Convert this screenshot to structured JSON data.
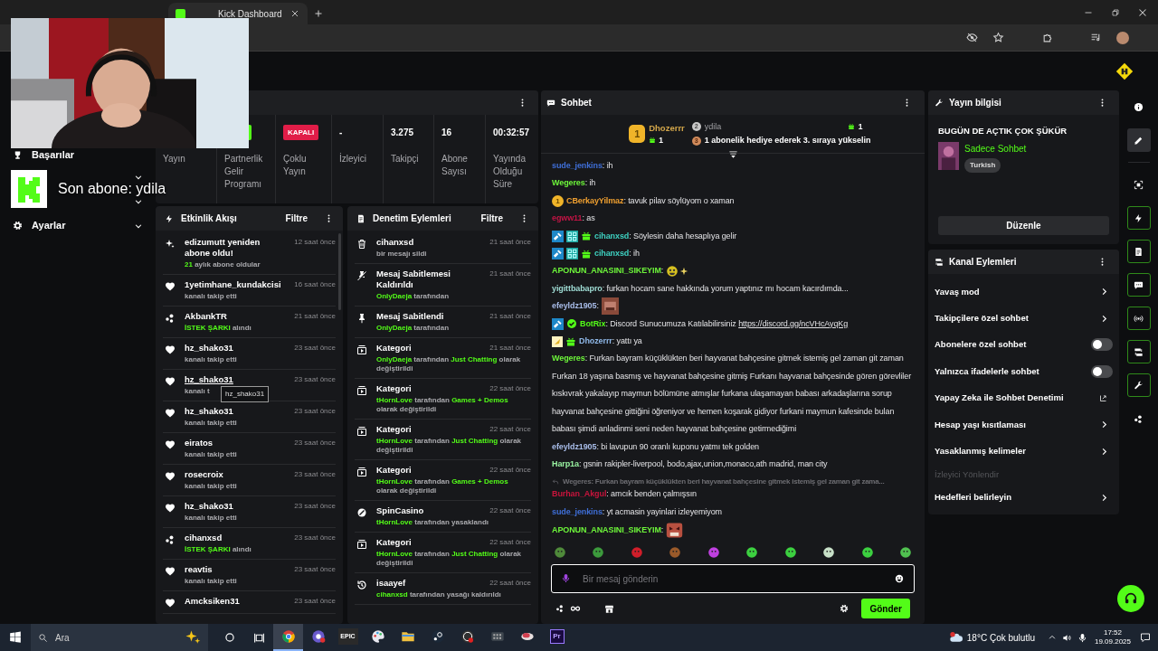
{
  "browser": {
    "tab_title": "Kick Dashboard"
  },
  "overlay": {
    "text": "Son abone: ydila"
  },
  "sidebar": {
    "items": [
      {
        "kind": "trophy",
        "label": "Başarılar"
      },
      {
        "kind": "group",
        "expanded": false
      },
      {
        "kind": "group",
        "expanded": false
      },
      {
        "kind": "gear",
        "label": "Ayarlar",
        "expanded": false
      }
    ]
  },
  "stats": [
    {
      "kind": "hidden",
      "label": "Yayın"
    },
    {
      "kind": "badge",
      "on": true,
      "label": "Partnerlik Gelir Programı"
    },
    {
      "kind": "badge",
      "on": false,
      "value": "KAPALI",
      "label": "Çoklu Yayın"
    },
    {
      "kind": "value",
      "value": "-",
      "label": "İzleyici"
    },
    {
      "kind": "value",
      "value": "3.275",
      "label": "Takipçi"
    },
    {
      "kind": "value",
      "value": "16",
      "label": "Abone Sayısı"
    },
    {
      "kind": "value",
      "value": "00:32:57",
      "label": "Yayında Olduğu Süre"
    }
  ],
  "activity": {
    "title": "Etkinlik Akışı",
    "filter": "Filtre",
    "items": [
      {
        "kind": "resub",
        "title": "edizumutt yeniden abone oldu!",
        "time": "12 saat önce",
        "sub": [
          {
            "text": "21",
            "highlight": true
          },
          {
            "text": " aylık abone oldular",
            "highlight": false
          }
        ]
      },
      {
        "kind": "follow",
        "title": "1yetimhane_kundakcisi",
        "time": "16 saat önce",
        "sub": [
          {
            "text": "kanalı takip etti",
            "highlight": false
          }
        ]
      },
      {
        "kind": "reward",
        "title": "AkbankTR",
        "time": "21 saat önce",
        "sub": [
          {
            "text": "İSTEK ŞARKI",
            "highlight": true
          },
          {
            "text": " alındı",
            "highlight": false
          }
        ]
      },
      {
        "kind": "follow",
        "title": "hz_shako31",
        "time": "23 saat önce",
        "sub": [
          {
            "text": "kanalı takip etti",
            "highlight": false
          }
        ]
      },
      {
        "kind": "follow",
        "title": "hz_shako31",
        "time": "23 saat önce",
        "tooltip": "hz_shako31",
        "sub": [
          {
            "text": "kanalı t",
            "highlight": false
          }
        ]
      },
      {
        "kind": "follow",
        "title": "hz_shako31",
        "time": "23 saat önce",
        "sub": [
          {
            "text": "kanalı takip etti",
            "highlight": false
          }
        ]
      },
      {
        "kind": "follow",
        "title": "eiratos",
        "time": "23 saat önce",
        "sub": [
          {
            "text": "kanalı takip etti",
            "highlight": false
          }
        ]
      },
      {
        "kind": "follow",
        "title": "rosecroix",
        "time": "23 saat önce",
        "sub": [
          {
            "text": "kanalı takip etti",
            "highlight": false
          }
        ]
      },
      {
        "kind": "follow",
        "title": "hz_shako31",
        "time": "23 saat önce",
        "sub": [
          {
            "text": "kanalı takip etti",
            "highlight": false
          }
        ]
      },
      {
        "kind": "reward",
        "title": "cihanxsd",
        "time": "23 saat önce",
        "sub": [
          {
            "text": "İSTEK ŞARKI",
            "highlight": true
          },
          {
            "text": " alındı",
            "highlight": false
          }
        ]
      },
      {
        "kind": "follow",
        "title": "reavtis",
        "time": "23 saat önce",
        "sub": [
          {
            "text": "kanalı takip etti",
            "highlight": false
          }
        ]
      },
      {
        "kind": "follow",
        "title": "Amcksiken31",
        "time": "23 saat önce"
      }
    ]
  },
  "moderation": {
    "title": "Denetim Eylemleri",
    "filter": "Filtre",
    "items": [
      {
        "kind": "delete",
        "title": "cihanxsd",
        "time": "21 saat önce",
        "sub": [
          {
            "text": "bir mesajı sildi",
            "highlight": false
          }
        ]
      },
      {
        "kind": "unpin",
        "title": "Mesaj Sabitlemesi Kaldırıldı",
        "time": "21 saat önce",
        "sub": [
          {
            "text": "OnlyDaeja",
            "highlight": true
          },
          {
            "text": " tarafından",
            "highlight": false
          }
        ]
      },
      {
        "kind": "pin",
        "title": "Mesaj Sabitlendi",
        "time": "21 saat önce",
        "sub": [
          {
            "text": "OnlyDaeja",
            "highlight": true
          },
          {
            "text": " tarafından",
            "highlight": false
          }
        ]
      },
      {
        "kind": "category",
        "title": "Kategori",
        "time": "21 saat önce",
        "sub": [
          {
            "text": "OnlyDaeja",
            "highlight": true
          },
          {
            "text": " tarafından ",
            "highlight": false
          },
          {
            "text": "Just Chatting",
            "highlight": true
          },
          {
            "text": " olarak değiştirildi",
            "highlight": false
          }
        ]
      },
      {
        "kind": "category",
        "title": "Kategori",
        "time": "22 saat önce",
        "sub": [
          {
            "text": "tHornLove",
            "highlight": true
          },
          {
            "text": " tarafından ",
            "highlight": false
          },
          {
            "text": "Games + Demos",
            "highlight": true
          },
          {
            "text": " olarak değiştirildi",
            "highlight": false
          }
        ]
      },
      {
        "kind": "category",
        "title": "Kategori",
        "time": "22 saat önce",
        "sub": [
          {
            "text": "tHornLove",
            "highlight": true
          },
          {
            "text": " tarafından ",
            "highlight": false
          },
          {
            "text": "Just Chatting",
            "highlight": true
          },
          {
            "text": " olarak değiştirildi",
            "highlight": false
          }
        ]
      },
      {
        "kind": "category",
        "title": "Kategori",
        "time": "22 saat önce",
        "sub": [
          {
            "text": "tHornLove",
            "highlight": true
          },
          {
            "text": " tarafından ",
            "highlight": false
          },
          {
            "text": "Games + Demos",
            "highlight": true
          },
          {
            "text": " olarak değiştirildi",
            "highlight": false
          }
        ]
      },
      {
        "kind": "ban",
        "title": "SpinCasino",
        "time": "22 saat önce",
        "sub": [
          {
            "text": "tHornLove",
            "highlight": true
          },
          {
            "text": " tarafından yasaklandı",
            "highlight": false
          }
        ]
      },
      {
        "kind": "category",
        "title": "Kategori",
        "time": "22 saat önce",
        "sub": [
          {
            "text": "tHornLove",
            "highlight": true
          },
          {
            "text": " tarafından ",
            "highlight": false
          },
          {
            "text": "Just Chatting",
            "highlight": true
          },
          {
            "text": " olarak değiştirildi",
            "highlight": false
          }
        ]
      },
      {
        "kind": "unban",
        "title": "isaayef",
        "time": "22 saat önce",
        "sub": [
          {
            "text": "cihanxsd",
            "highlight": true
          },
          {
            "text": " tarafından yasağı kaldırıldı",
            "highlight": false
          }
        ]
      }
    ]
  },
  "chat": {
    "title": "Sohbet",
    "leaderboard": [
      {
        "rank": "1",
        "user": "Dhozerrr",
        "gifts": "1"
      },
      {
        "rank": "2",
        "user": "ydila",
        "gifts": "1"
      },
      {
        "rank": "3",
        "text": "1 abonelik hediye ederek 3. sıraya yükselin"
      }
    ],
    "messages": [
      {
        "user": "sude_jenkins",
        "color": "#3f6fd8",
        "text": ": ih"
      },
      {
        "user": "Wegeres",
        "color": "#6df53a",
        "text": ": ih"
      },
      {
        "badges": [
          {
            "kind": "rank",
            "text": "1"
          }
        ],
        "user": "CBerkayYilmaz",
        "color": "#f0a030",
        "text": ": tavuk pilav söylüyom o xaman"
      },
      {
        "user": "egww11",
        "color": "#c21445",
        "text": ": as"
      },
      {
        "badges": [
          {
            "kind": "mod"
          },
          {
            "kind": "og"
          },
          {
            "kind": "sub"
          }
        ],
        "user": "cihanxsd",
        "color": "#3ed0c0",
        "text": ": Söylesin daha hesaplıya gelir"
      },
      {
        "badges": [
          {
            "kind": "mod"
          },
          {
            "kind": "og"
          },
          {
            "kind": "sub"
          }
        ],
        "user": "cihanxsd",
        "color": "#3ed0c0",
        "text": ": ih"
      },
      {
        "user": "APONUN_ANASINI_SIKEYIM",
        "color": "#6df53a",
        "text": ":",
        "emotes": [
          {
            "kind": "smiley"
          },
          {
            "kind": "sparkle"
          }
        ]
      },
      {
        "user": "yigittbabapro",
        "color": "#9fdcd4",
        "text": ": furkan hocam sane hakkında yorum yaptınız mı hocam kacırdımda..."
      },
      {
        "user": "efeyldz1905",
        "color": "#a8bce8",
        "text": ":"
      },
      {
        "badges": [
          {
            "kind": "mod"
          },
          {
            "kind": "verified"
          }
        ],
        "user": "BotRix",
        "color": "#53fc18",
        "text": ": Discord Sunucumuza Katılabilirsiniz ",
        "link": "https://discord.gg/ncVHcAyqKg"
      },
      {
        "badges": [
          {
            "kind": "founder"
          },
          {
            "kind": "sub"
          }
        ],
        "user": "Dhozerrr",
        "color": "#8fb8e8",
        "text": ": yattı ya"
      },
      {
        "user": "Wegeres",
        "color": "#6df53a",
        "text": ": Furkan bayram küçüklükten beri hayvanat bahçesine gitmek istemiş gel zaman git zaman Furkan 18 yaşına basmış ve hayvanat bahçesine gitmiş Furkanı hayvanat bahçesinde gören görevliler kıskıvrak yakalayıp maymun bölümüne atmışlar furkana ulaşamayan babası arkadaşlarına sorup hayvanat bahçesine gittiğini öğreniyor ve hemen koşarak gidiyor furkani maymun kafesinde bulan babası şimdi anladinmi seni neden hayvanat bahçesine getirmediğimi"
      },
      {
        "user": "efeyldz1905",
        "color": "#a8bce8",
        "text": ": bi lavupun 90 oranlı kuponu yatmı tek golden"
      },
      {
        "user": "Harp1a",
        "color": "#98f0a0",
        "text": ": gsnin rakipler-liverpool, bodo,ajax,union,monaco,ath madrid, man city"
      },
      {
        "reply": "Wegeres: Furkan bayram küçüklükten beri hayvanat bahçesine gitmek istemiş gel zaman git zama...",
        "user": "Burhan_Akgul",
        "color": "#c8143c",
        "text": ": amcık benden çalmışsın"
      },
      {
        "user": "sude_jenkins",
        "color": "#3f6fd8",
        "text": ": yt acmasin yayinlari izleyemiyom"
      },
      {
        "user": "APONUN_ANASINI_SIKEYIM",
        "color": "#6df53a",
        "text": ":",
        "emotes": [
          {
            "kind": "face"
          }
        ]
      }
    ],
    "quick_emotes": [
      {
        "color": "#4f8a3a"
      },
      {
        "color": "#3c9a3c"
      },
      {
        "color": "#d01e2a"
      },
      {
        "color": "#9a5a2a"
      },
      {
        "color": "#c040e0"
      },
      {
        "color": "#3cd040"
      },
      {
        "color": "#3cd040"
      },
      {
        "color": "#c8e0c8"
      },
      {
        "color": "#3cd040"
      },
      {
        "color": "#50c050"
      }
    ],
    "input": {
      "placeholder": "Bir mesaj gönderin"
    },
    "send": "Gönder"
  },
  "stream_info": {
    "title": "Yayın bilgisi",
    "stream_title": "BUGÜN DE AÇTIK ÇOK ŞÜKÜR",
    "category": "Sadece Sohbet",
    "tag": "Turkish",
    "edit": "Düzenle"
  },
  "channel_actions": {
    "title": "Kanal Eylemleri",
    "items": [
      {
        "kind": "submenu",
        "label": "Yavaş mod"
      },
      {
        "kind": "submenu",
        "label": "Takipçilere özel sohbet"
      },
      {
        "kind": "toggle",
        "label": "Abonelere özel sohbet",
        "on": false
      },
      {
        "kind": "toggle",
        "label": "Yalnızca ifadelerle sohbet",
        "on": false
      },
      {
        "kind": "external",
        "label": "Yapay Zeka ile Sohbet Denetimi"
      },
      {
        "kind": "submenu",
        "label": "Hesap yaşı kısıtlaması"
      },
      {
        "kind": "submenu",
        "label": "Yasaklanmış kelimeler"
      },
      {
        "kind": "section",
        "label": "İzleyici Yönlendir"
      },
      {
        "kind": "submenu",
        "label": "Hedefleri belirleyin"
      }
    ]
  },
  "rail": [
    {
      "kind": "info",
      "selected": false,
      "on": false
    },
    {
      "kind": "pencil",
      "selected": true,
      "on": false
    },
    {
      "kind": "focus",
      "selected": false,
      "on": false
    },
    {
      "kind": "bolt",
      "selected": false,
      "on": true
    },
    {
      "kind": "doc",
      "selected": false,
      "on": true
    },
    {
      "kind": "chat",
      "selected": false,
      "on": true
    },
    {
      "kind": "broadcast",
      "selected": false,
      "on": true
    },
    {
      "kind": "camswap",
      "selected": false,
      "on": true
    },
    {
      "kind": "wrench",
      "selected": false,
      "on": true
    },
    {
      "kind": "dots",
      "selected": false,
      "on": false
    }
  ],
  "taskbar": {
    "search": "Ara",
    "apps": [
      {
        "kind": "chrome",
        "active": true
      },
      {
        "kind": "chat",
        "active": false
      },
      {
        "kind": "epic",
        "label": "EPIC",
        "active": false
      },
      {
        "kind": "palette",
        "active": false
      },
      {
        "kind": "folder",
        "active": false
      },
      {
        "kind": "steam",
        "active": false
      },
      {
        "kind": "record",
        "active": false
      },
      {
        "kind": "grid",
        "active": false
      },
      {
        "kind": "creature",
        "active": false
      },
      {
        "kind": "premiere",
        "label": "Pr",
        "active": false
      }
    ],
    "weather": "18°C Çok bulutlu",
    "time": "17:52",
    "date": "19.09.2025"
  }
}
